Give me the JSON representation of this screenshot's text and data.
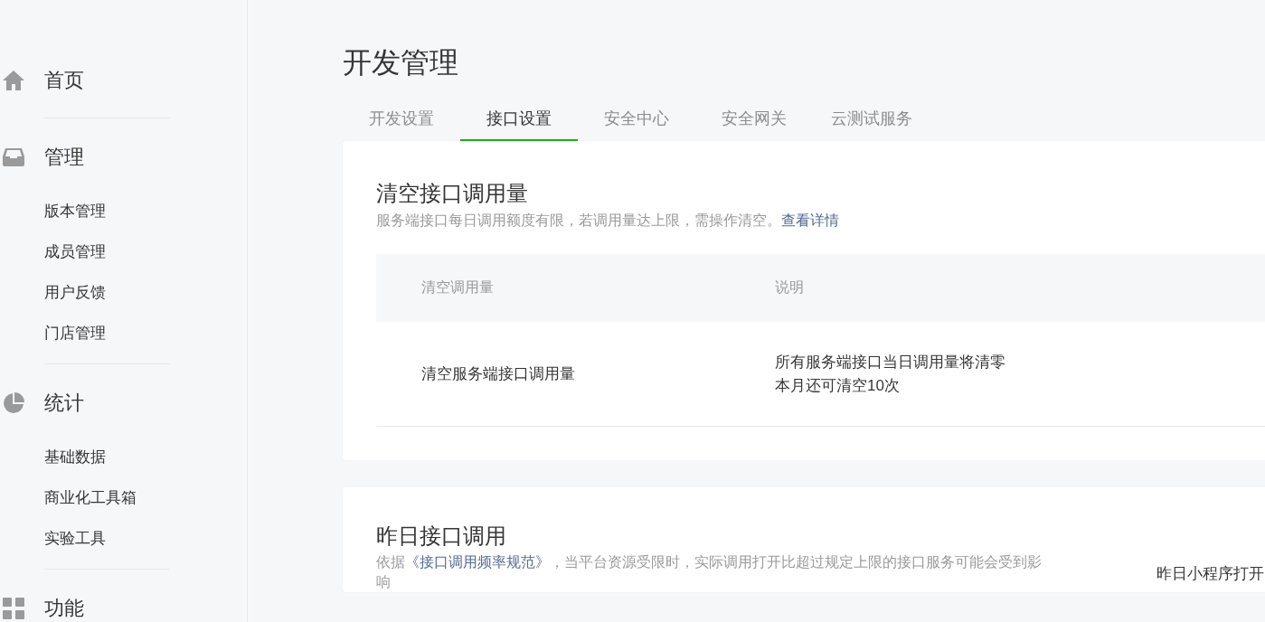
{
  "sidebar": {
    "sections": [
      {
        "title": "首页"
      },
      {
        "title": "管理",
        "items": [
          "版本管理",
          "成员管理",
          "用户反馈",
          "门店管理"
        ]
      },
      {
        "title": "统计",
        "items": [
          "基础数据",
          "商业化工具箱",
          "实验工具"
        ]
      },
      {
        "title": "功能"
      }
    ]
  },
  "page_title": "开发管理",
  "tabs": [
    {
      "label": "开发设置",
      "selected": false
    },
    {
      "label": "接口设置",
      "selected": true
    },
    {
      "label": "安全中心",
      "selected": false
    },
    {
      "label": "安全网关",
      "selected": false
    },
    {
      "label": "云测试服务",
      "selected": false
    }
  ],
  "clear_card": {
    "title": "清空接口调用量",
    "description": "服务端接口每日调用额度有限，若调用量达上限，需操作清空。",
    "link": "查看详情",
    "table": {
      "columns": [
        "清空调用量",
        "说明"
      ],
      "rows": [
        {
          "name": "清空服务端接口调用量",
          "notes": [
            "所有服务端接口当日调用量将清零",
            "本月还可清空10次"
          ]
        }
      ]
    }
  },
  "yesterday_card": {
    "title": "昨日接口调用",
    "description_prefix": "依据",
    "link": "《接口调用频率规范》",
    "description_suffix": "，当平台资源受限时，实际调用打开比超过规定上限的接口服务可能会受到影响",
    "side_label": "昨日小程序打开"
  }
}
